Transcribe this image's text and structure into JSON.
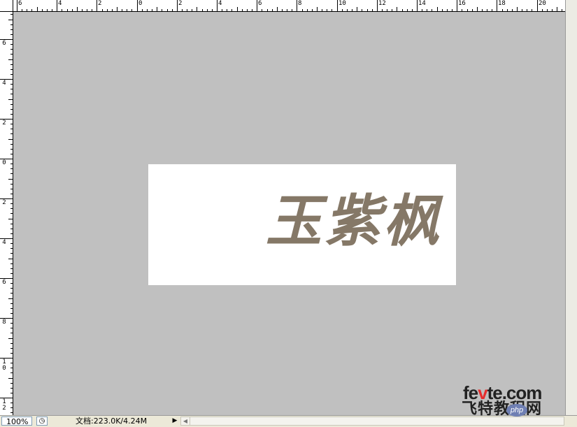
{
  "ruler_top": {
    "labels": [
      "6",
      "4",
      "2",
      "0",
      "2",
      "4",
      "6",
      "8",
      "10",
      "12",
      "14",
      "16",
      "18",
      "20"
    ]
  },
  "ruler_left": {
    "labels": [
      "6",
      "4",
      "2",
      "0",
      "2",
      "4",
      "6",
      "8",
      "10",
      "12"
    ]
  },
  "canvas": {
    "text": "玉紫枫",
    "text_color": "#857867",
    "background": "#ffffff"
  },
  "workspace": {
    "background": "#c0c0c0"
  },
  "status": {
    "zoom": "100%",
    "doc_info": "文档:223.0K/4.24M",
    "status_icon": "clock-icon",
    "menu_arrow": "▶",
    "scroll_left": "◀"
  },
  "watermark": {
    "brand_a": "fe",
    "brand_b": "v",
    "brand_c": "te.com",
    "cn": "飞特教程网",
    "badge": "php"
  }
}
